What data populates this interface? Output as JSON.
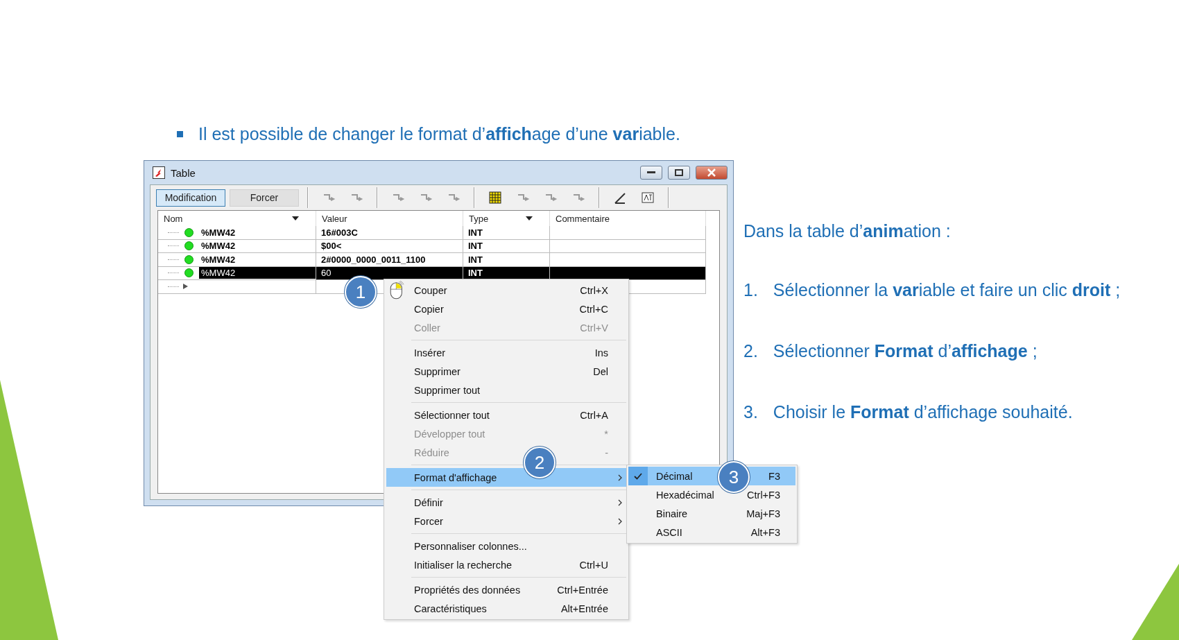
{
  "bullet": "Il est possible de changer le format d’**affich**age d’une **var**iable.",
  "window": {
    "title": "Table",
    "mode_buttons": [
      {
        "label": "Modification",
        "selected": true
      },
      {
        "label": "Forcer",
        "selected": false
      }
    ],
    "columns": [
      "Nom",
      "Valeur",
      "Type",
      "Commentaire"
    ],
    "rows": [
      {
        "name": "%MW42",
        "value": "16#003C",
        "type": "INT",
        "selected": false
      },
      {
        "name": "%MW42",
        "value": "$00<",
        "type": "INT",
        "selected": false
      },
      {
        "name": "%MW42",
        "value": "2#0000_0000_0011_1100",
        "type": "INT",
        "selected": false
      },
      {
        "name": "%MW42",
        "value": "60",
        "type": "INT",
        "selected": true
      }
    ]
  },
  "context_menu": {
    "groups": [
      [
        {
          "label": "Couper",
          "shortcut": "Ctrl+X",
          "disabled": false,
          "submenu": false,
          "selected": false
        },
        {
          "label": "Copier",
          "shortcut": "Ctrl+C",
          "disabled": false,
          "submenu": false,
          "selected": false
        },
        {
          "label": "Coller",
          "shortcut": "Ctrl+V",
          "disabled": true,
          "submenu": false,
          "selected": false
        }
      ],
      [
        {
          "label": "Insérer",
          "shortcut": "Ins",
          "disabled": false,
          "submenu": false,
          "selected": false
        },
        {
          "label": "Supprimer",
          "shortcut": "Del",
          "disabled": false,
          "submenu": false,
          "selected": false
        },
        {
          "label": "Supprimer tout",
          "disabled": false,
          "submenu": false,
          "selected": false
        }
      ],
      [
        {
          "label": "Sélectionner tout",
          "shortcut": "Ctrl+A",
          "disabled": false,
          "submenu": false,
          "selected": false
        },
        {
          "label": "Développer tout",
          "shortcut": "*",
          "disabled": true,
          "submenu": false,
          "selected": false
        },
        {
          "label": "Réduire",
          "shortcut": "-",
          "disabled": true,
          "submenu": false,
          "selected": false
        }
      ],
      [
        {
          "label": "Format d'affichage",
          "disabled": false,
          "submenu": true,
          "selected": true
        }
      ],
      [
        {
          "label": "Définir",
          "disabled": false,
          "submenu": true,
          "selected": false
        },
        {
          "label": "Forcer",
          "disabled": false,
          "submenu": true,
          "selected": false
        }
      ],
      [
        {
          "label": "Personnaliser colonnes...",
          "disabled": false,
          "submenu": false,
          "selected": false
        },
        {
          "label": "Initialiser la recherche",
          "shortcut": "Ctrl+U",
          "disabled": false,
          "submenu": false,
          "selected": false
        }
      ],
      [
        {
          "label": "Propriétés des données",
          "shortcut": "Ctrl+Entrée",
          "disabled": false,
          "submenu": false,
          "selected": false
        },
        {
          "label": "Caractéristiques",
          "shortcut": "Alt+Entrée",
          "disabled": false,
          "submenu": false,
          "selected": false
        }
      ]
    ]
  },
  "submenu": [
    {
      "label": "Décimal",
      "shortcut": "F3",
      "checked": true,
      "selected": true
    },
    {
      "label": "Hexadécimal",
      "shortcut": "Ctrl+F3",
      "checked": false,
      "selected": false
    },
    {
      "label": "Binaire",
      "shortcut": "Maj+F3",
      "checked": false,
      "selected": false
    },
    {
      "label": "ASCII",
      "shortcut": "Alt+F3",
      "checked": false,
      "selected": false
    }
  ],
  "callouts": [
    "1",
    "2",
    "3"
  ],
  "instructions": {
    "intro": "Dans la table d’**anim**ation :",
    "steps": [
      {
        "number": "1.",
        "text": "Sélectionner la **var**iable et faire un clic **droit** ;"
      },
      {
        "number": "2.",
        "text": "Sélectionner **Format** d’**affichage** ;"
      },
      {
        "number": "3.",
        "text": "Choisir le **Format** d’affichage souhaité."
      }
    ]
  }
}
